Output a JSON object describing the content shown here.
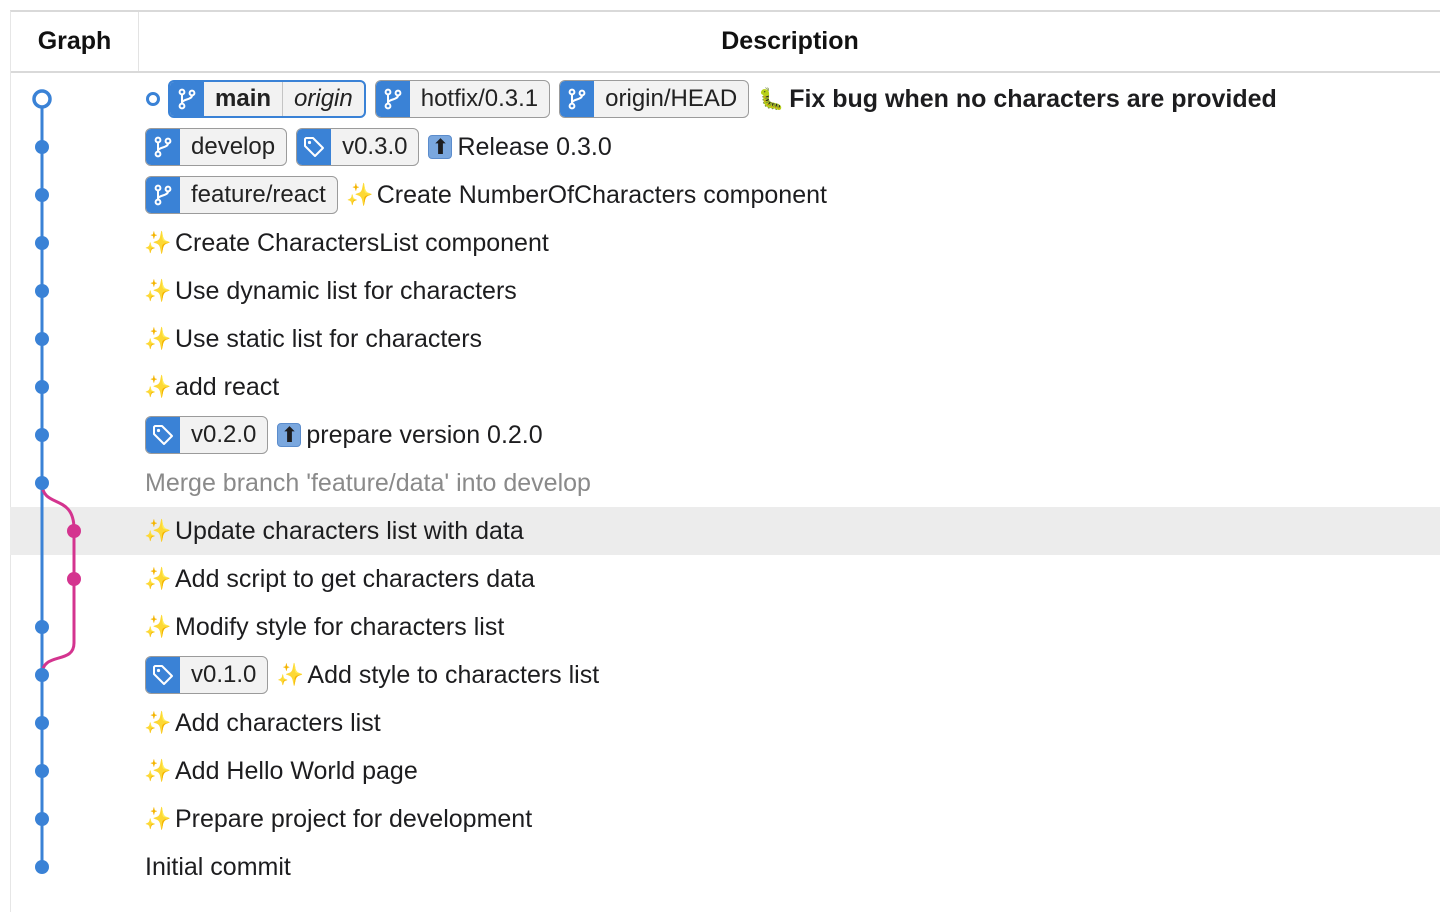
{
  "columns": {
    "graph": "Graph",
    "description": "Description"
  },
  "colors": {
    "main_lane": "#3a82d6",
    "feature_lane": "#d4348f",
    "ref_icon_bg": "#3a82d6",
    "selected_row": "#ececec"
  },
  "commits": [
    {
      "message": "Fix bug when no characters are provided",
      "emoji": "bug-emoji",
      "bold": true,
      "head": true,
      "refs": [
        {
          "type": "branch",
          "label": "main",
          "remote": "origin",
          "current": true
        },
        {
          "type": "branch",
          "label": "hotfix/0.3.1"
        },
        {
          "type": "branch",
          "label": "origin/HEAD"
        }
      ]
    },
    {
      "message": "Release 0.3.0",
      "emoji": "up-arrow-emoji",
      "refs": [
        {
          "type": "branch",
          "label": "develop"
        },
        {
          "type": "tag",
          "label": "v0.3.0"
        }
      ]
    },
    {
      "message": "Create NumberOfCharacters component",
      "emoji": "sparkles-emoji",
      "refs": [
        {
          "type": "branch",
          "label": "feature/react"
        }
      ]
    },
    {
      "message": "Create CharactersList component",
      "emoji": "sparkles-emoji",
      "refs": []
    },
    {
      "message": "Use dynamic list for characters",
      "emoji": "sparkles-emoji",
      "refs": []
    },
    {
      "message": "Use static list for characters",
      "emoji": "sparkles-emoji",
      "refs": []
    },
    {
      "message": "add react",
      "emoji": "sparkles-emoji",
      "refs": []
    },
    {
      "message": "prepare version 0.2.0",
      "emoji": "up-arrow-emoji",
      "refs": [
        {
          "type": "tag",
          "label": "v0.2.0"
        }
      ]
    },
    {
      "message": "Merge branch 'feature/data' into develop",
      "emoji": "",
      "muted": true,
      "refs": []
    },
    {
      "message": "Update characters list with data",
      "emoji": "sparkles-emoji",
      "selected": true,
      "refs": []
    },
    {
      "message": "Add script to get characters data",
      "emoji": "sparkles-emoji",
      "refs": []
    },
    {
      "message": "Modify style for characters list",
      "emoji": "sparkles-emoji",
      "refs": []
    },
    {
      "message": "Add style to characters list",
      "emoji": "sparkles-emoji",
      "refs": [
        {
          "type": "tag",
          "label": "v0.1.0"
        }
      ]
    },
    {
      "message": "Add characters list",
      "emoji": "sparkles-emoji",
      "refs": []
    },
    {
      "message": "Add Hello World page",
      "emoji": "sparkles-emoji",
      "refs": []
    },
    {
      "message": "Prepare project for development",
      "emoji": "sparkles-emoji",
      "refs": []
    },
    {
      "message": "Initial commit",
      "emoji": "",
      "refs": []
    }
  ]
}
